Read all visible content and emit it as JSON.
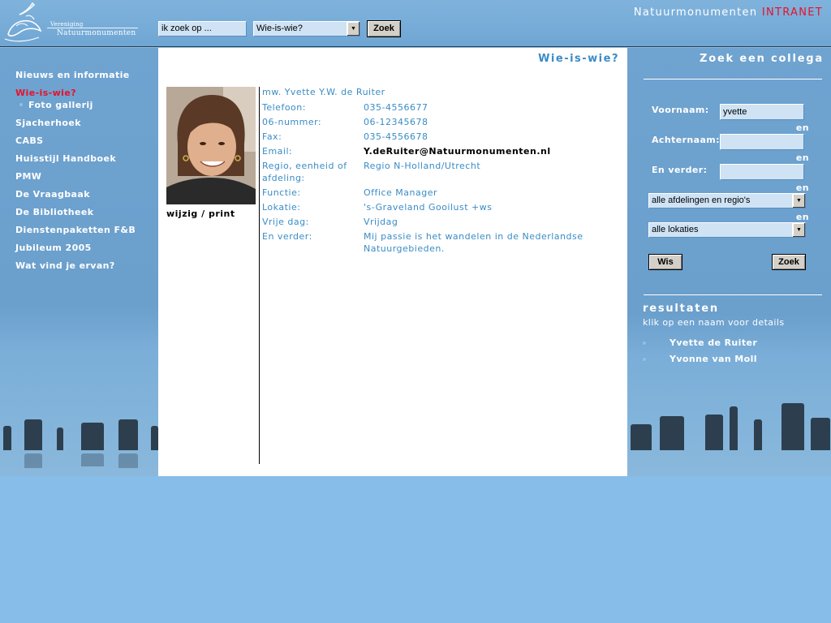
{
  "header": {
    "logo_line1": "Vereniging",
    "logo_line2": "Natuurmonumenten",
    "search_value": "ik zoek op ...",
    "search_select_value": "Wie-is-wie?",
    "search_button": "Zoek",
    "brand_prefix": "Natuurmonumenten",
    "brand_suffix": "INTRANET"
  },
  "nav": {
    "items": [
      {
        "label": "Nieuws en informatie"
      },
      {
        "label": "Wie-is-wie?"
      },
      {
        "label": "Foto gallerij"
      },
      {
        "label": "Sjacherhoek"
      },
      {
        "label": "CABS"
      },
      {
        "label": "Huisstijl Handboek"
      },
      {
        "label": "PMW"
      },
      {
        "label": "De Vraagbaak"
      },
      {
        "label": "De Bibliotheek"
      },
      {
        "label": "Dienstenpaketten F&B"
      },
      {
        "label": "Jubileum 2005"
      },
      {
        "label": "Wat vind je ervan?"
      }
    ]
  },
  "main": {
    "title": "Wie-is-wie?",
    "edit_link": "wijzig",
    "separator": "/",
    "print_link": "print",
    "person": {
      "name": "mw. Yvette Y.W. de Ruiter",
      "rows": [
        {
          "label": "Telefoon:",
          "value": "035-4556677"
        },
        {
          "label": "06-nummer:",
          "value": "06-12345678"
        },
        {
          "label": "Fax:",
          "value": "035-4556678"
        },
        {
          "label": "Email:",
          "value": "Y.deRuiter@Natuurmonumenten.nl"
        },
        {
          "label": "Regio, eenheid of afdeling:",
          "value": "Regio N-Holland/Utrecht"
        },
        {
          "label": "Functie:",
          "value": "Office Manager"
        },
        {
          "label": "Lokatie:",
          "value": "'s-Graveland Gooilust +ws"
        },
        {
          "label": "Vrije dag:",
          "value": "Vrijdag"
        },
        {
          "label": "En verder:",
          "value": "Mij passie is het wandelen in de Nederlandse Natuurgebieden."
        }
      ]
    }
  },
  "search_panel": {
    "title": "Zoek een collega",
    "voornaam_label": "Voornaam:",
    "voornaam_value": "yvette",
    "achternaam_label": "Achternaam:",
    "achternaam_value": "",
    "verder_label": "En verder:",
    "verder_value": "",
    "connector": "en",
    "afdeling_select": "alle afdelingen en regio's",
    "lokatie_select": "alle lokaties",
    "clear_button": "Wis",
    "search_button": "Zoek",
    "results_title": "resultaten",
    "results_hint": "klik op een naam voor details",
    "results": [
      {
        "name": "Yvette de Ruiter"
      },
      {
        "name": "Yvonne van Moll"
      }
    ]
  },
  "colors": {
    "accent_blue": "#3a8cc6",
    "brand_red": "#e8102a",
    "sky_blue": "#86bde9"
  }
}
